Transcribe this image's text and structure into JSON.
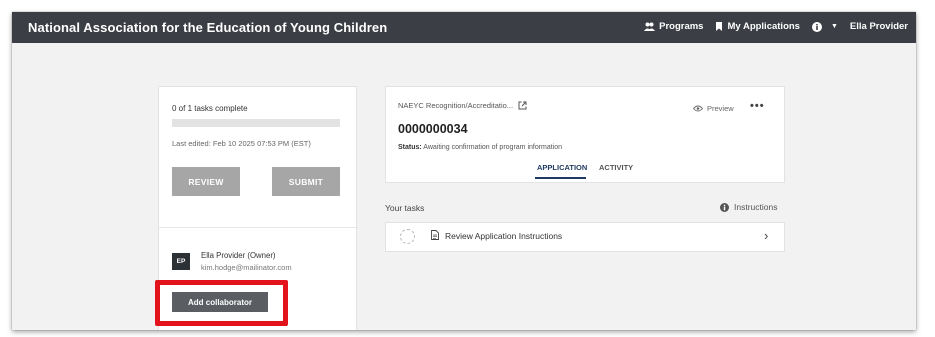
{
  "header": {
    "app_title": "National Association for the Education of Young Children",
    "nav": [
      {
        "label": "Programs",
        "icon": "users-icon"
      },
      {
        "label": "My Applications",
        "icon": "bookmark-icon"
      },
      {
        "label": "",
        "icon": "info-icon"
      },
      {
        "label": "Ella Provider",
        "icon": ""
      }
    ]
  },
  "progress_panel": {
    "tasks_complete": "0 of 1 tasks complete",
    "progress_fraction": 0,
    "last_edited": "Last edited: Feb 10 2025 07:53 PM (EST)",
    "review_label": "REVIEW",
    "submit_label": "SUBMIT"
  },
  "collaborators": {
    "avatar_initials": "EP",
    "owner_name": "Ella Provider (Owner)",
    "owner_email": "kim.hodge@mailinator.com",
    "add_label": "Add collaborator"
  },
  "application": {
    "program": "NAEYC Recognition/Accreditatio...",
    "preview_label": "Preview",
    "more_label": "•••",
    "number": "0000000034",
    "status_label": "Status:",
    "status_value": "Awaiting confirmation of program information",
    "tabs": [
      "APPLICATION",
      "ACTIVITY"
    ],
    "active_tab": "APPLICATION"
  },
  "tasks": {
    "heading": "Your tasks",
    "instructions_label": "Instructions",
    "items": [
      {
        "label": "Review Application Instructions"
      }
    ]
  },
  "colors": {
    "topbar": "#3b3e44",
    "highlight": "#e2131a",
    "accent": "#1f3a5f"
  }
}
